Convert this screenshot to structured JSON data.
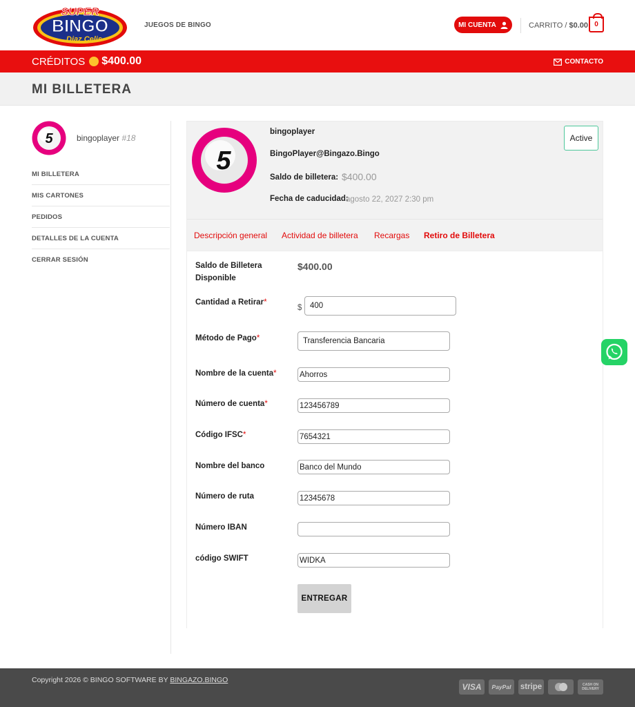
{
  "header": {
    "logo_text": [
      "SUPER",
      "BINGO",
      "Diaz Celis"
    ],
    "nav_item": "JUEGOS DE BINGO",
    "account_button": "MI CUENTA",
    "cart_word": "CARRITO /",
    "cart_total": "$0.00",
    "cart_count": "0"
  },
  "topbar": {
    "credits_label": "CRÉDITOS",
    "credits_amount": "$400.00",
    "contact": "CONTACTO"
  },
  "page_title": "MI BILLETERA",
  "sidebar": {
    "avatar_number": "5",
    "username": "bingoplayer",
    "user_id": "#18",
    "menu": [
      "MI BILLETERA",
      "MIS CARTONES",
      "PEDIDOS",
      "DETALLES DE LA CUENTA",
      "CERRAR SESIÓN"
    ]
  },
  "profile": {
    "avatar_number": "5",
    "name": "bingoplayer",
    "email": "BingoPlayer@Bingazo.Bingo",
    "balance_label": "Saldo de billetera:",
    "balance_value": "$400.00",
    "expiry_label": "Fecha de caducidad:",
    "expiry_value": "agosto 22, 2027 2:30 pm",
    "status": "Active"
  },
  "tabs": [
    {
      "label": "Descripción general",
      "active": false
    },
    {
      "label": "Actividad de billetera",
      "active": false
    },
    {
      "label": "Recargas",
      "active": false
    },
    {
      "label": "Retiro de Billetera",
      "active": true
    }
  ],
  "form": {
    "available_label": "Saldo de Billetera Disponible",
    "available_value": "$400.00",
    "amount_label": "Cantidad a Retirar",
    "currency_symbol": "$",
    "amount_value": "400",
    "method_label": "Método de Pago",
    "method_value": "Transferencia Bancaria",
    "account_name_label": "Nombre de la cuenta",
    "account_name_value": "Ahorros",
    "account_number_label": "Número de cuenta",
    "account_number_value": "123456789",
    "ifsc_label": "Código IFSC",
    "ifsc_value": "7654321",
    "bank_name_label": "Nombre del banco",
    "bank_name_value": "Banco del Mundo",
    "routing_label": "Número de ruta",
    "routing_value": "12345678",
    "iban_label": "Número IBAN",
    "iban_value": "",
    "swift_label": "código SWIFT",
    "swift_value": "WIDKA",
    "required_mark": "*",
    "submit": "ENTREGAR"
  },
  "footer": {
    "copyright": "Copyright 2026 © BINGO SOFTWARE BY ",
    "link": "BINGAZO.BINGO",
    "payments": [
      "VISA",
      "PayPal",
      "stripe",
      "",
      "CASH ON DELIVERY"
    ]
  },
  "colors": {
    "brand_red": "#e20b0b",
    "bar_red": "#e80f0f",
    "coin_yellow": "#fdc32c",
    "status_border": "#4cc79a",
    "whatsapp_green": "#25d366",
    "footer_bg": "#4a4a4a"
  },
  "icons": [
    "user-icon",
    "envelope-icon",
    "whatsapp-icon",
    "bingo-ball-avatar",
    "coin-icon",
    "cart-icon"
  ]
}
